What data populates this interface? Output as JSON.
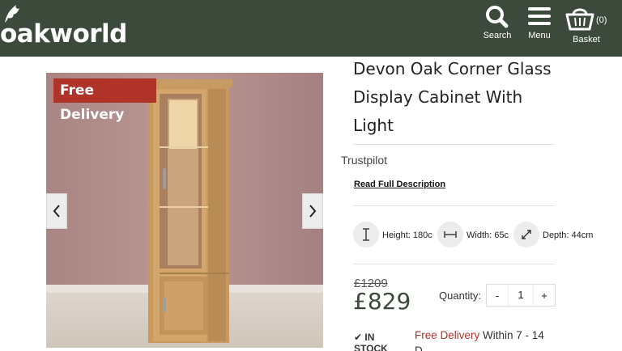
{
  "header": {
    "logo_text": "oakworld",
    "search_label": "Search",
    "menu_label": "Menu",
    "basket_label": "Basket",
    "basket_count": "(0)"
  },
  "gallery": {
    "badge": "Free Delivery"
  },
  "product": {
    "title_line1": "Devon Oak Corner Glass",
    "title_line2": "Display Cabinet With",
    "title_line3": "Light",
    "trustpilot": "Trustpilot",
    "read_description": "Read Full Description",
    "height": "Height: 180c",
    "width": "Width: 65c",
    "depth": "Depth: 44cm",
    "old_price": "£1209",
    "price": "£829",
    "quantity_label": "Quantity:",
    "quantity_value": "1",
    "qty_minus": "-",
    "qty_plus": "+",
    "stock_line1": "IN",
    "stock_line2": "STOCK",
    "delivery_red": "Free Delivery",
    "delivery_rest": " Within 7 - 14",
    "delivery_line2": "D"
  }
}
